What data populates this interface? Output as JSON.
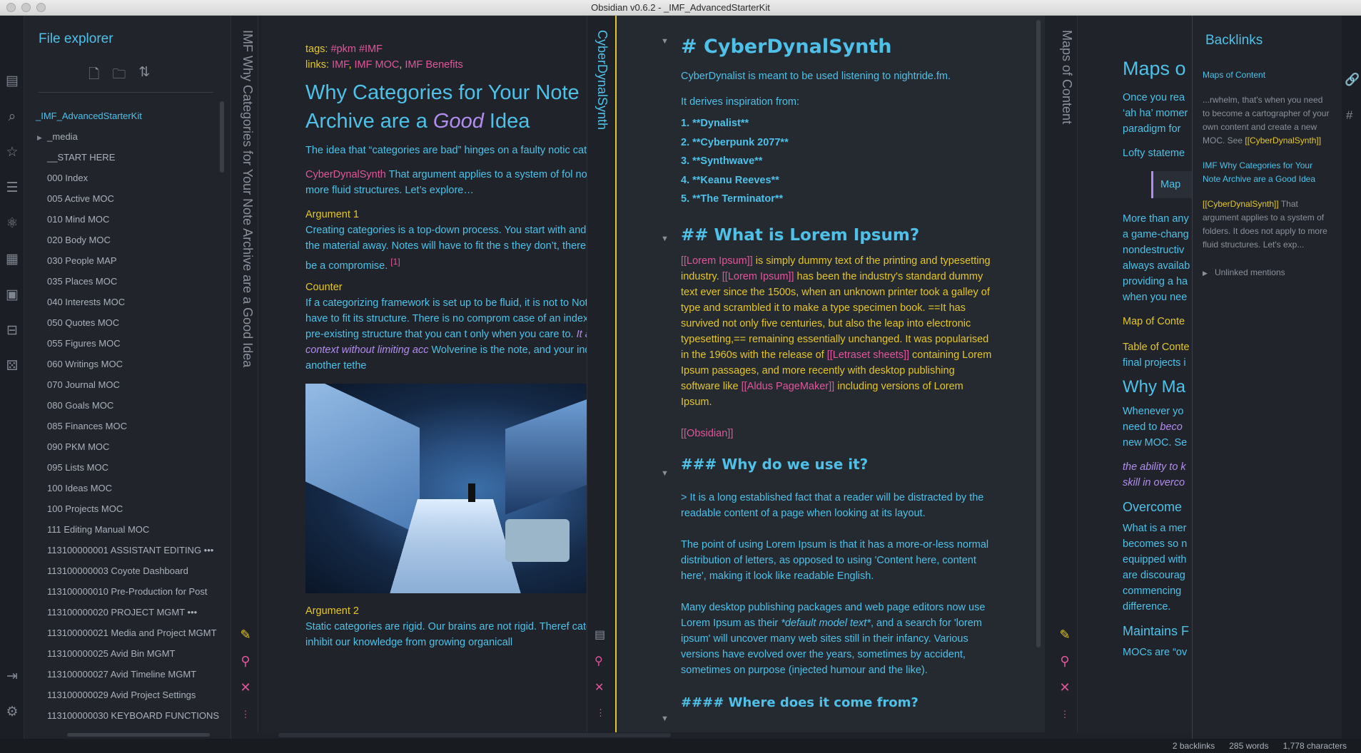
{
  "window": {
    "title": "Obsidian v0.6.2 - _IMF_AdvancedStarterKit"
  },
  "sidebar": {
    "title": "File explorer",
    "items": [
      "_IMF_AdvancedStarterKit",
      "_media",
      "__START HERE",
      "000 Index",
      "005 Active MOC",
      "010 Mind MOC",
      "020 Body MOC",
      "030 People MAP",
      "035 Places MOC",
      "040 Interests MOC",
      "050 Quotes MOC",
      "055 Figures MOC",
      "060 Writings MOC",
      "070 Journal MOC",
      "080 Goals MOC",
      "085 Finances MOC",
      "090 PKM MOC",
      "095 Lists MOC",
      "100 Ideas MOC",
      "100 Projects MOC",
      "111 Editing Manual MOC",
      "113100000001 ASSISTANT EDITING •••",
      "113100000003 Coyote Dashboard",
      "113100000010 Pre-Production for Post",
      "113100000020 PROJECT MGMT •••",
      "113100000021 Media and Project MGMT",
      "113100000025 Avid Bin MGMT",
      "113100000027 Avid Timeline MGMT",
      "113100000029 Avid Project Settings",
      "113100000030 KEYBOARD FUNCTIONS"
    ]
  },
  "pane1": {
    "strip_title": "IMF Why Categories for Your Note Archive are a Good Idea",
    "tags_label": "tags: ",
    "tags": "#pkm #IMF",
    "links_label": "links: ",
    "link1": "IMF",
    "link2": "IMF MOC",
    "link3": "IMF Benefits",
    "title_a": "Why Categories for Your Note Archive are a ",
    "title_b": "Good",
    "title_c": " Idea",
    "p1": "The idea that “categories are bad” hinges on a faulty notic categories limit access and cause rigidity that inhibit orga",
    "p2a": "CyberDynalSynth",
    "p2b": " That argument applies to a system of fol not apply to more fluid structures. Let’s explore…",
    "arg1": "Argument 1",
    "p3": "Creating categories is a top-down process. You start with and then file the material away. Notes will have to fit the s they don’t, there’ll have to be a compromise.",
    "fn": "[1]",
    "counter": "Counter",
    "p4": "If a categorizing framework is set up to be fluid, it is not to Notes do not have to fit its structure. There is no comprom case of an index, it’s a pre-existing structure that you can t only when you care to.",
    "p4i": "It adds context without limiting acc",
    "p4b": "Wolverine is the note, and your index is just another tethe",
    "arg2": "Argument 2",
    "p5": "Static categories are rigid. Our brains are not rigid. Theref categories inhibit our knowledge from growing organicall"
  },
  "pane2": {
    "strip_title": "CyberDynalSynth",
    "h1": "# CyberDynalSynth",
    "intro": "CyberDynalist is meant to be used listening to nightride.fm.",
    "derives": "It derives inspiration from:",
    "list": [
      "1. **Dynalist**",
      "2. **Cyberpunk 2077**",
      "3. **Synthwave**",
      "4. **Keanu Reeves**",
      "5. **The Terminator**"
    ],
    "h2": "## What is Lorem Ipsum?",
    "lorem_link1": "[[Lorem Ipsum]]",
    "lorem_t1": " is simply dummy text of the printing and typesetting industry. ",
    "lorem_link2": "[[Lorem Ipsum]]",
    "lorem_t2": " has been the industry's standard dummy text ever since the 1500s, when an unknown printer took a galley of type and scrambled it to make a type specimen book. ==It has survived not only five centuries, but also the leap into electronic typesetting,== remaining essentially unchanged. It was popularised in the 1960s with the release of ",
    "lorem_link3": "[[Letraset sheets]]",
    "lorem_t3": " containing Lorem Ipsum passages, and more recently with desktop publishing software like ",
    "lorem_link4": "[[Aldus PageMaker]]",
    "lorem_t4": " including versions of Lorem Ipsum.",
    "obsidian": "[[Obsidian]]",
    "h3": "### Why do we use it?",
    "quote": "> It is a long established fact that a reader will be distracted by the readable content of a page when looking at its layout.",
    "p_point": "The point of using Lorem Ipsum is that it has a more-or-less normal distribution of letters, as opposed to using 'Content here, content here', making it look like readable English.",
    "p_many_a": "Many desktop publishing packages and web page editors now use Lorem Ipsum as their ",
    "p_many_i": "*default model text*",
    "p_many_b": ", and a search for 'lorem ipsum' will uncover many web sites still in their infancy. Various versions have evolved over the years, sometimes by accident, sometimes on purpose (injected humour and the like).",
    "h4": "#### Where does it come from?"
  },
  "pane3": {
    "strip_title": "Maps of Content",
    "title": "Maps o",
    "p1": "Once you rea ‘ah ha’ momer paradigm for",
    "p2": "Lofty stateme",
    "box": "Map",
    "p3": "More than any a game-chang nondestructiv always availab providing a ha when you nee",
    "l1": "Map of Conte",
    "l2": "Table of Conte",
    "p4": "final projects i",
    "h2": "Why Ma",
    "p5a": "Whenever yo need to ",
    "p5i": "beco",
    "p5b": " new MOC. Se",
    "p6": "the ability to k skill in overco",
    "h3": "Overcome",
    "p7": "What is a mer becomes so n equipped with are discourag commencing difference.",
    "h4": "Maintains F",
    "p8": "MOCs are “ov"
  },
  "backlinks": {
    "title": "Backlinks",
    "src1": "Maps of Content",
    "ex1": "...rwhelm, that's when you need to become a cartographer of your own content and create a new MOC. See ",
    "ex1_link": "[[CyberDynalSynth]]",
    "src2": "IMF Why Categories for Your Note Archive are a Good Idea",
    "ex2_link": "[[CyberDynalSynth]]",
    "ex2": " That argument applies to a system of folders. It does not apply to more fluid structures. Let's exp...",
    "unlinked": "Unlinked mentions"
  },
  "status": {
    "backlinks": "2 backlinks",
    "words": "285 words",
    "chars": "1,778 characters"
  }
}
